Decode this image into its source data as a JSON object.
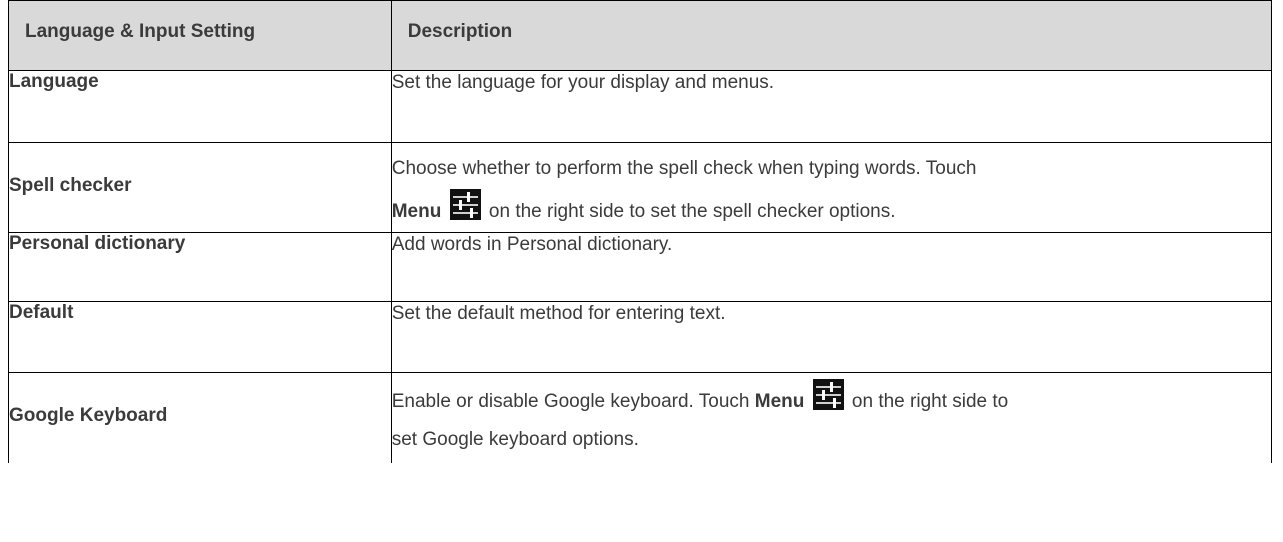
{
  "header": {
    "col1": "Language & Input Setting",
    "col2": "Description"
  },
  "rows": [
    {
      "setting": "Language",
      "description": "Set the language for your display and menus."
    },
    {
      "setting": "Spell checker",
      "description_line1": "Choose whether to perform the spell check when typing words. Touch",
      "description_bold": "Menu",
      "description_line2_rest": "on the right side to set the spell checker options.",
      "icon": "settings-sliders-icon"
    },
    {
      "setting": "Personal dictionary",
      "description": "Add words in Personal dictionary."
    },
    {
      "setting": "Default",
      "description": "Set the default method for entering text."
    },
    {
      "setting": "Google Keyboard",
      "description_pre": "Enable or disable Google keyboard. Touch",
      "description_bold": "Menu",
      "description_post": "on the right side to",
      "description_line2": "set Google keyboard options.",
      "icon": "settings-sliders-icon"
    }
  ],
  "colors": {
    "header_bg": "#d9d9d9",
    "text": "#3b3b3b",
    "border": "#000000",
    "icon_bg": "#111111"
  }
}
